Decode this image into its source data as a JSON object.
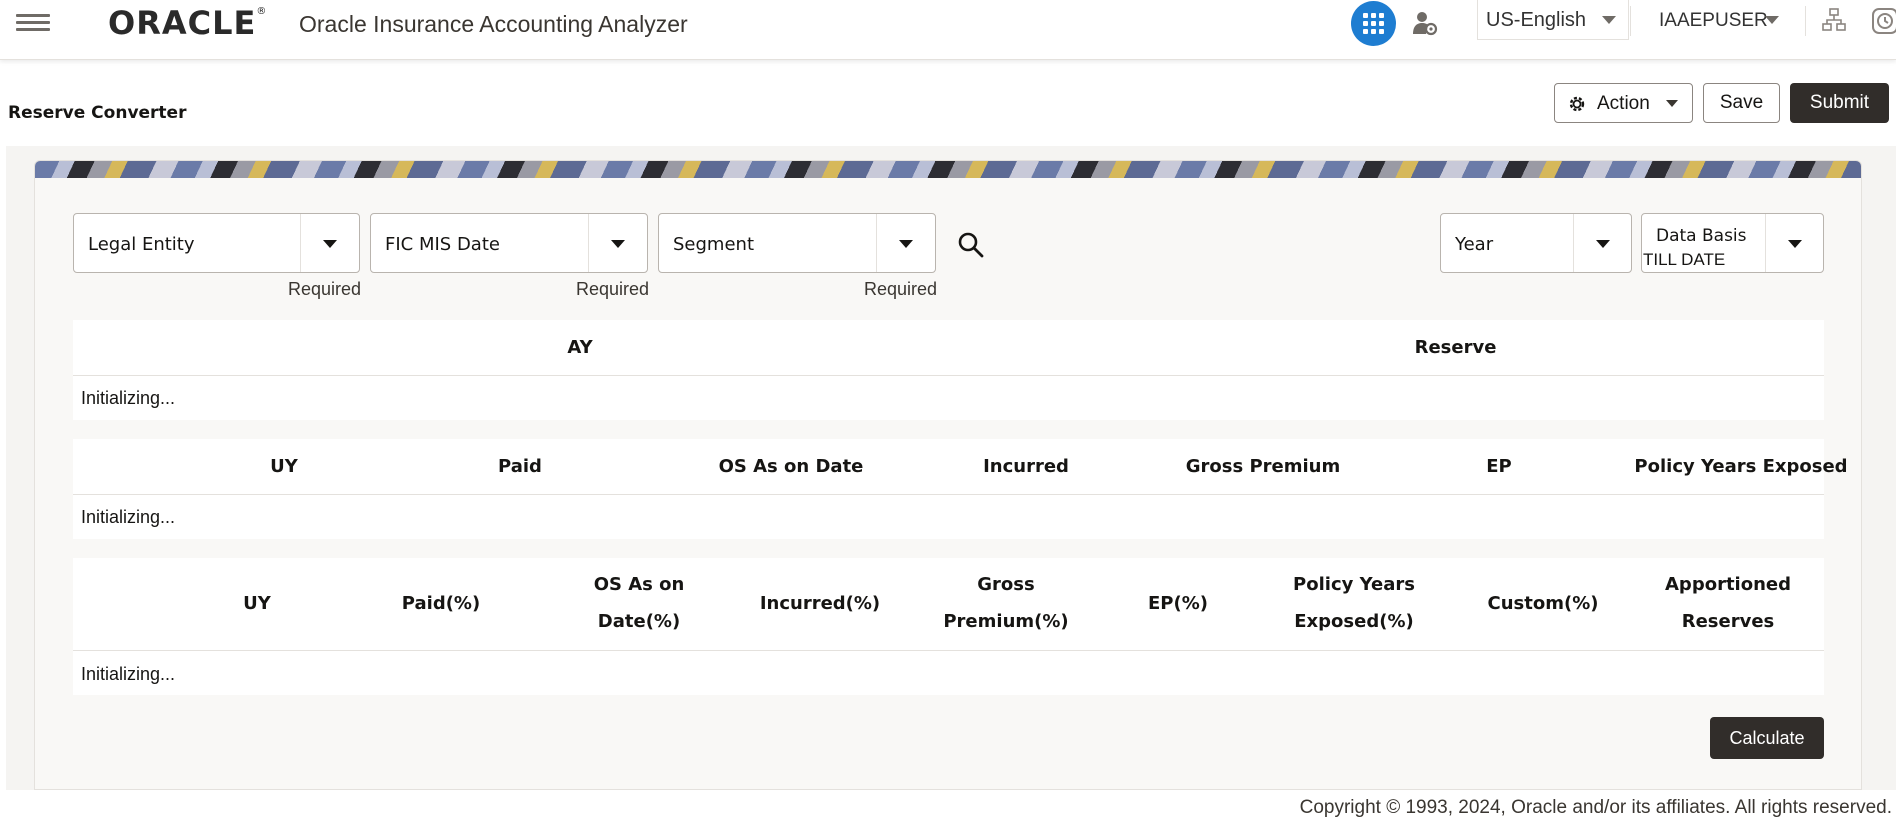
{
  "header": {
    "logo": "ORACLE",
    "logo_mark": "®",
    "app_title": "Oracle Insurance Accounting Analyzer",
    "language": "US-English",
    "user": "IAAEPUSER"
  },
  "page": {
    "title": "Reserve Converter",
    "action_label": "Action",
    "save_label": "Save",
    "submit_label": "Submit"
  },
  "filters": {
    "legal_entity": "Legal Entity",
    "fic_mis_date": "FIC MIS Date",
    "segment": "Segment",
    "required": "Required",
    "year": "Year",
    "data_basis_label": "Data Basis",
    "data_basis_value": "TILL DATE"
  },
  "table1": {
    "headers": [
      "AY",
      "Reserve"
    ],
    "status": "Initializing..."
  },
  "table2": {
    "headers": [
      "UY",
      "Paid",
      "OS As on Date",
      "Incurred",
      "Gross Premium",
      "EP",
      "Policy Years Exposed"
    ],
    "status": "Initializing..."
  },
  "table3": {
    "headers": [
      "UY",
      "Paid(%)",
      "OS As on Date(%)",
      "Incurred(%)",
      "Gross Premium(%)",
      "EP(%)",
      "Policy Years Exposed(%)",
      "Custom(%)",
      "Apportioned Reserves"
    ],
    "status": "Initializing..."
  },
  "calculate_label": "Calculate",
  "footer": "Copyright © 1993, 2024, Oracle and/or its affiliates. All rights reserved.",
  "colors": {
    "primary_dark": "#312d2a",
    "accent_blue": "#1e7dd1"
  }
}
